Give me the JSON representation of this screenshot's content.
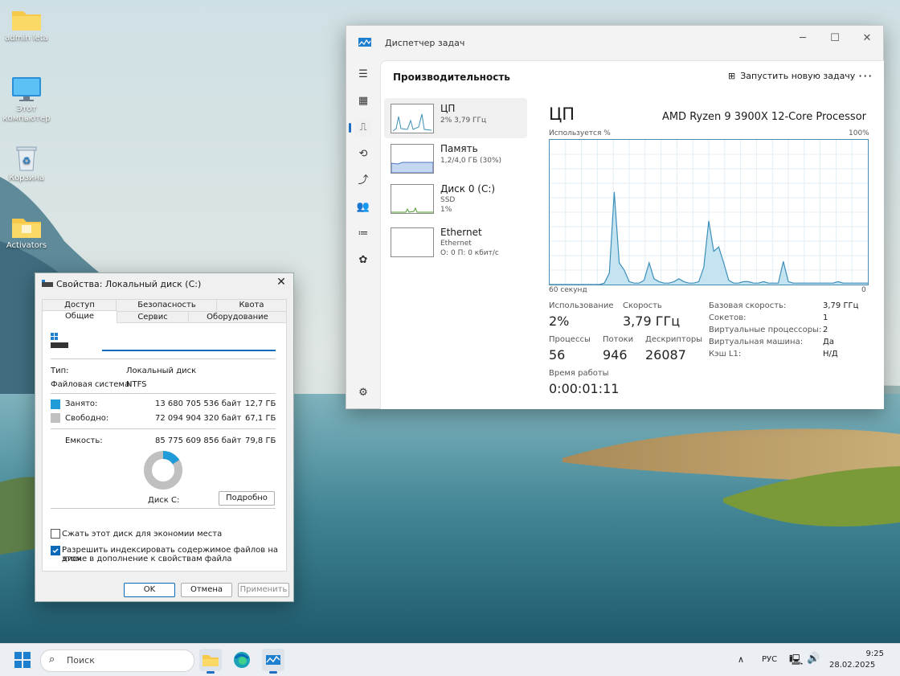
{
  "desktop": {
    "icons": [
      {
        "label": "admin leta",
        "icon": "folder-icon"
      },
      {
        "label": "Этот компьютер",
        "icon": "monitor-icon"
      },
      {
        "label": "Корзина",
        "icon": "recycle-bin-icon"
      },
      {
        "label": "Activators",
        "icon": "folder-icon"
      }
    ]
  },
  "task_manager": {
    "title": "Диспетчер задач",
    "page_title": "Производительность",
    "run_task": "Запустить новую задачу",
    "more": "···",
    "resources": [
      {
        "name": "ЦП",
        "sub1": "2% 3,79 ГГц",
        "sub2": "",
        "selected": true
      },
      {
        "name": "Память",
        "sub1": "1,2/4,0 ГБ (30%)",
        "sub2": "",
        "selected": false
      },
      {
        "name": "Диск 0 (C:)",
        "sub1": "SSD",
        "sub2": "1%",
        "selected": false
      },
      {
        "name": "Ethernet",
        "sub1": "Ethernet",
        "sub2": "О: 0 П: 0 кбит/с",
        "selected": false
      }
    ],
    "cpu": {
      "heading": "ЦП",
      "processor": "AMD Ryzen 9 3900X 12-Core Processor",
      "usage_label": "Используется %",
      "max_label": "100%",
      "time_left_label": "60 секунд",
      "time_right_label": "0",
      "stats": {
        "usage_label": "Использование",
        "usage_value": "2%",
        "speed_label": "Скорость",
        "speed_value": "3,79 ГГц",
        "proc_label": "Процессы",
        "proc_value": "56",
        "threads_label": "Потоки",
        "threads_value": "946",
        "handles_label": "Дескрипторы",
        "handles_value": "26087",
        "uptime_label": "Время работы",
        "uptime_value": "0:00:01:11"
      },
      "details": [
        {
          "k": "Базовая скорость:",
          "v": "3,79 ГГц"
        },
        {
          "k": "Сокетов:",
          "v": "1"
        },
        {
          "k": "Виртуальные процессоры:",
          "v": "2"
        },
        {
          "k": "Виртуальная машина:",
          "v": "Да"
        },
        {
          "k": "Кэш L1:",
          "v": "Н/Д"
        }
      ],
      "graph_values": [
        0,
        0,
        0,
        0,
        0,
        0,
        0,
        0,
        0,
        0,
        0,
        1,
        8,
        64,
        15,
        10,
        2,
        1,
        1,
        3,
        15,
        4,
        2,
        1,
        1,
        2,
        4,
        2,
        1,
        1,
        2,
        12,
        44,
        23,
        26,
        15,
        3,
        1,
        1,
        2,
        2,
        1,
        1,
        2,
        1,
        1,
        1,
        16,
        2,
        1,
        1,
        1,
        1,
        1,
        1,
        1,
        1,
        1,
        2,
        1,
        1,
        1,
        1,
        1,
        1
      ]
    },
    "accent_color": "#3c8fb8",
    "graph_fill": "#c5e4f2"
  },
  "properties": {
    "title": "Свойства: Локальный диск (C:)",
    "tabs_row1": [
      "Доступ",
      "Безопасность",
      "Квота"
    ],
    "tabs_row2": [
      "Общие",
      "Сервис",
      "Оборудование"
    ],
    "name_value": "",
    "type_label": "Тип:",
    "type_value": "Локальный диск",
    "fs_label": "Файловая система:",
    "fs_value": "NTFS",
    "used_label": "Занято:",
    "used_bytes": "13 680 705 536 байт",
    "used_gb": "12,7 ГБ",
    "free_label": "Свободно:",
    "free_bytes": "72 094 904 320 байт",
    "free_gb": "67,1 ГБ",
    "cap_label": "Емкость:",
    "cap_bytes": "85 775 609 856 байт",
    "cap_gb": "79,8 ГБ",
    "used_fraction": 0.16,
    "disk_label": "Диск C:",
    "details_button": "Подробно",
    "compress_label": "Сжать этот диск для экономии места",
    "compress_checked": false,
    "index_label_1": "Разрешить индексировать содержимое файлов на этом",
    "index_label_2": "диске в дополнение к свойствам файла",
    "index_checked": true,
    "ok": "OK",
    "cancel": "Отмена",
    "apply": "Применить",
    "used_color": "#1f9bd7",
    "free_color": "#c0c0c0"
  },
  "taskbar": {
    "search_placeholder": "Поиск",
    "lang": "РУС",
    "time": "9:25",
    "date": "28.02.2025"
  }
}
